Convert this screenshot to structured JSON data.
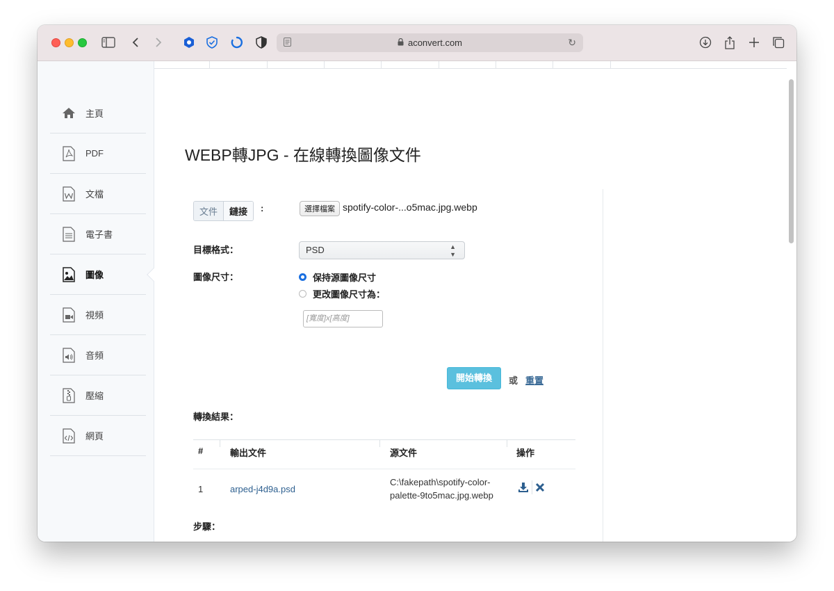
{
  "browser": {
    "url": "aconvert.com"
  },
  "sidebar": {
    "items": [
      {
        "label": "主頁",
        "icon": "home-icon"
      },
      {
        "label": "PDF",
        "icon": "pdf-file-icon"
      },
      {
        "label": "文檔",
        "icon": "word-file-icon"
      },
      {
        "label": "電子書",
        "icon": "ebook-file-icon"
      },
      {
        "label": "圖像",
        "icon": "image-file-icon",
        "active": true
      },
      {
        "label": "視頻",
        "icon": "video-file-icon"
      },
      {
        "label": "音頻",
        "icon": "audio-file-icon"
      },
      {
        "label": "壓縮",
        "icon": "archive-file-icon"
      },
      {
        "label": "網頁",
        "icon": "webpage-file-icon"
      }
    ]
  },
  "main": {
    "title": "WEBP轉JPG - 在線轉換圖像文件",
    "source_tabs": {
      "file": "文件",
      "link": "鏈接",
      "colon": ":"
    },
    "file_button": "選擇檔案",
    "file_name": "spotify-color-...o5mac.jpg.webp",
    "target_format_label": "目標格式：",
    "target_format_value": "PSD",
    "image_size_label": "圖像尺寸：",
    "size_options": [
      "保持源圖像尺寸",
      "更改圖像尺寸為："
    ],
    "size_selected": 0,
    "size_placeholder": "[寬度]x[高度]",
    "convert_button": "開始轉換",
    "or_text": "或",
    "reset_link": "重置",
    "results_label": "轉換結果：",
    "results": {
      "headers": [
        "#",
        "輸出文件",
        "源文件",
        "操作"
      ],
      "rows": [
        {
          "index": "1",
          "output": "arped-j4d9a.psd",
          "source_line1": "C:\\fakepath\\spotify-color-",
          "source_line2": "palette-9to5mac.jpg.webp"
        }
      ]
    },
    "steps_label": "步驟："
  },
  "colors": {
    "accent_button": "#5bc0de",
    "link": "#2d5f8f",
    "radio_selected": "#1a6fe0"
  }
}
